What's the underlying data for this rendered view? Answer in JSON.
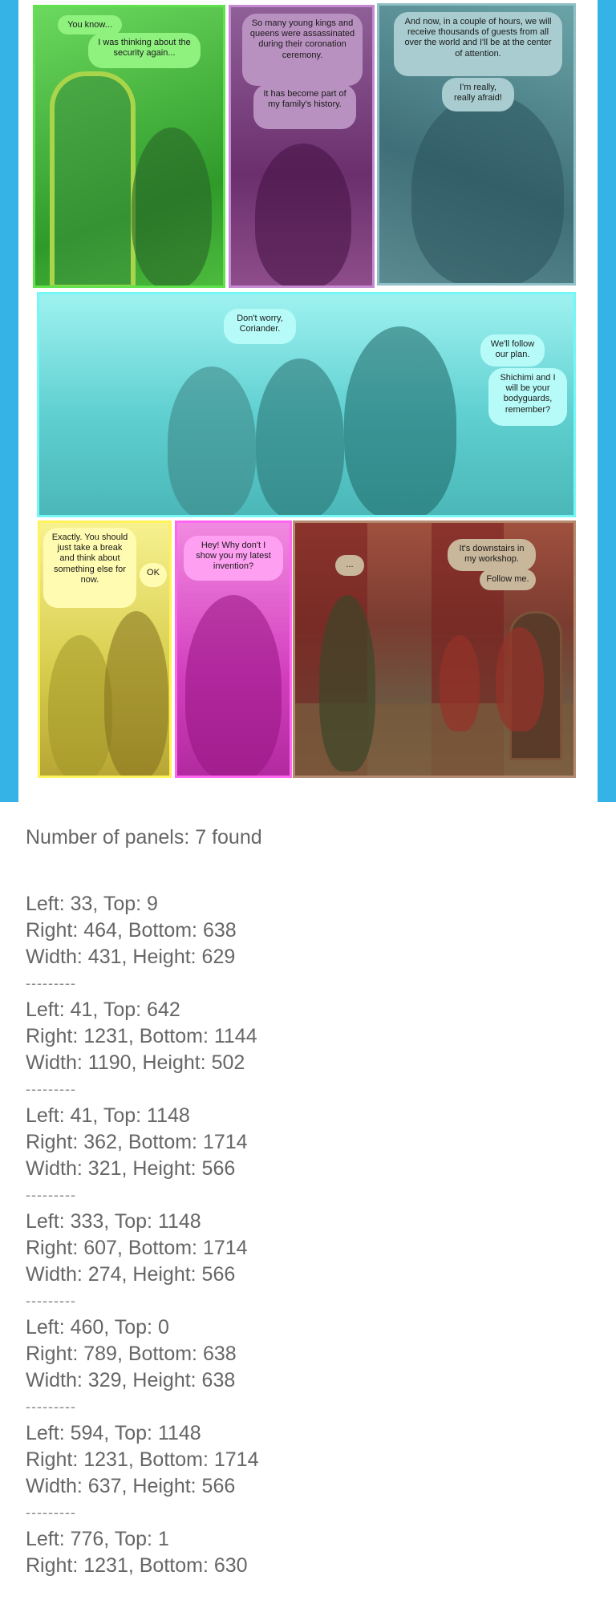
{
  "comic": {
    "panel1": {
      "bubble_a": "You know...",
      "bubble_b": "I was thinking about the security again..."
    },
    "panel2": {
      "bubble_a": "So many young kings and queens were assassinated during their coronation ceremony.",
      "bubble_b": "It has become part of my family's history."
    },
    "panel3": {
      "bubble_a": "And now, in a couple of hours, we will receive thousands of guests from all over the world and I'll be at the center of attention.",
      "bubble_b": "I'm really, really afraid!"
    },
    "panel4": {
      "bubble_a": "Don't worry, Coriander.",
      "bubble_b": "We'll follow our plan.",
      "bubble_c": "Shichimi and I will be your bodyguards, remember?"
    },
    "panel5": {
      "bubble_a": "Exactly. You should just take a break and think about something else for now.",
      "bubble_b": "OK"
    },
    "panel6": {
      "bubble_a": "Hey! Why don't I show you my latest invention?"
    },
    "panel7": {
      "bubble_a": "...",
      "bubble_b": "It's downstairs in my workshop.",
      "bubble_c": "Follow me."
    },
    "overlay_colors": [
      "#5fe24c",
      "#c58ad0",
      "#8fc0c6",
      "#74f7f7",
      "#fff25a",
      "#ff66ef",
      "#b48a70"
    ]
  },
  "results": {
    "summary": "Number of panels: 7 found",
    "separator": "---------",
    "rects": [
      {
        "pos": "Left: 33, Top: 9",
        "end": "Right: 464, Bottom: 638",
        "size": "Width: 431, Height: 629"
      },
      {
        "pos": "Left: 41, Top: 642",
        "end": "Right: 1231, Bottom: 1144",
        "size": "Width: 1190, Height: 502"
      },
      {
        "pos": "Left: 41, Top: 1148",
        "end": "Right: 362, Bottom: 1714",
        "size": "Width: 321, Height: 566"
      },
      {
        "pos": "Left: 333, Top: 1148",
        "end": "Right: 607, Bottom: 1714",
        "size": "Width: 274, Height: 566"
      },
      {
        "pos": "Left: 460, Top: 0",
        "end": "Right: 789, Bottom: 638",
        "size": "Width: 329, Height: 638"
      },
      {
        "pos": "Left: 594, Top: 1148",
        "end": "Right: 1231, Bottom: 1714",
        "size": "Width: 637, Height: 566"
      },
      {
        "pos": "Left: 776, Top: 1",
        "end": "Right: 1231, Bottom: 630",
        "size": ""
      }
    ]
  }
}
